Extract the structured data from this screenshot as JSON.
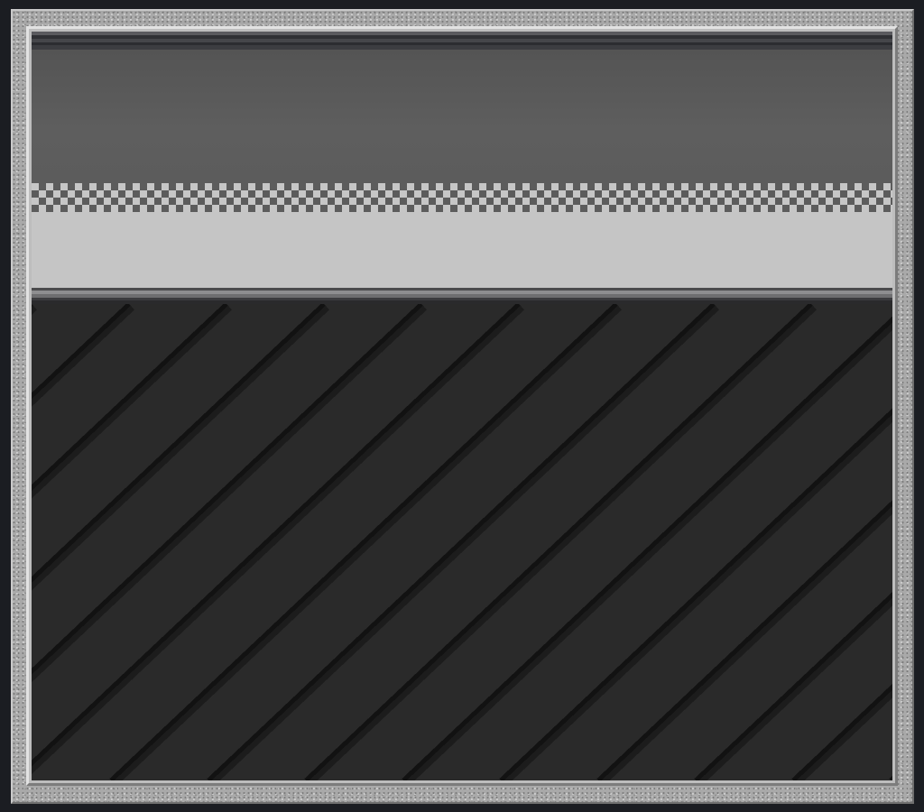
{
  "scene": {
    "frame": {
      "style": "speckled-stone",
      "outer_color": "#a9a9a9",
      "inner_color": "#bdbdbd"
    },
    "wall": {
      "panel_color": "#5b5b5b",
      "rim_color": "#3c3d41"
    },
    "checker_strip": {
      "light_color": "#c6c6c6",
      "dark_color": "#5c5c5c"
    },
    "ledge": {
      "color": "#c5c5c5",
      "lip_color": "#6e6e70"
    },
    "floor": {
      "base_color": "#2a2a2a",
      "stripe_color": "#121212",
      "stripe_highlight_color": "#1c1c1c",
      "pattern": "diagonal-stripes"
    }
  }
}
